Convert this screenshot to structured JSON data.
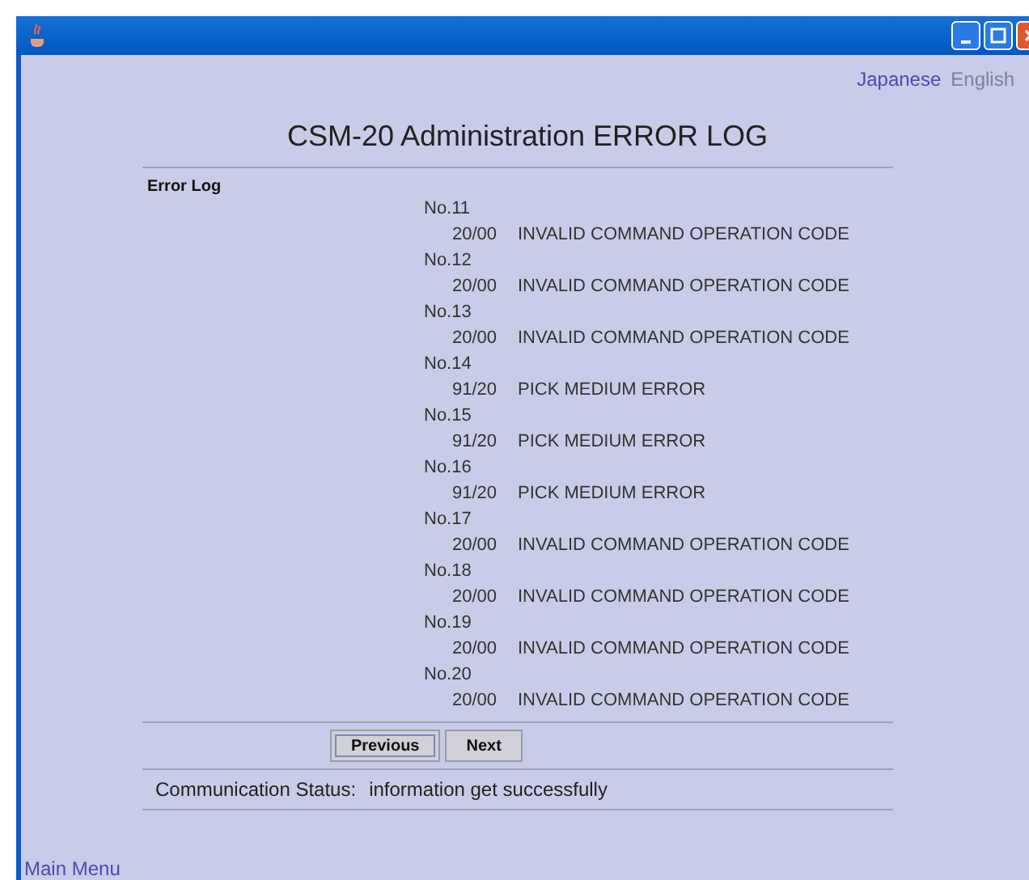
{
  "languages": [
    {
      "label": "Japanese",
      "selected": false
    },
    {
      "label": "English",
      "selected": true
    }
  ],
  "title": "CSM-20 Administration ERROR LOG",
  "section_label": "Error Log",
  "entries": [
    {
      "number": "No.11",
      "code": "20/00",
      "message": "INVALID COMMAND OPERATION CODE"
    },
    {
      "number": "No.12",
      "code": "20/00",
      "message": "INVALID COMMAND OPERATION CODE"
    },
    {
      "number": "No.13",
      "code": "20/00",
      "message": "INVALID COMMAND OPERATION CODE"
    },
    {
      "number": "No.14",
      "code": "91/20",
      "message": "PICK MEDIUM ERROR"
    },
    {
      "number": "No.15",
      "code": "91/20",
      "message": "PICK MEDIUM ERROR"
    },
    {
      "number": "No.16",
      "code": "91/20",
      "message": "PICK MEDIUM ERROR"
    },
    {
      "number": "No.17",
      "code": "20/00",
      "message": "INVALID COMMAND OPERATION CODE"
    },
    {
      "number": "No.18",
      "code": "20/00",
      "message": "INVALID COMMAND OPERATION CODE"
    },
    {
      "number": "No.19",
      "code": "20/00",
      "message": "INVALID COMMAND OPERATION CODE"
    },
    {
      "number": "No.20",
      "code": "20/00",
      "message": "INVALID COMMAND OPERATION CODE"
    }
  ],
  "buttons": [
    {
      "label": "Previous",
      "focused": true
    },
    {
      "label": "Next",
      "focused": false
    }
  ],
  "status": {
    "label": "Communication Status:",
    "value": "information get successfully"
  },
  "footer_link": "Main Menu"
}
